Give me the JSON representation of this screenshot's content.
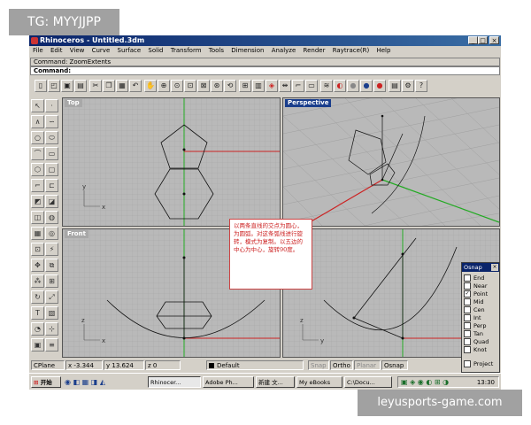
{
  "watermark_top": "TG: MYYJJPP",
  "watermark_bottom": "leyusports-game.com",
  "window": {
    "title": "Rhinoceros - Untitled.3dm",
    "buttons": [
      "_",
      "□",
      "×"
    ]
  },
  "menu": [
    "File",
    "Edit",
    "View",
    "Curve",
    "Surface",
    "Solid",
    "Transform",
    "Tools",
    "Dimension",
    "Analyze",
    "Render",
    "Raytrace(R)",
    "Help"
  ],
  "command_history": "Command: ZoomExtents",
  "command_prompt": "Command:",
  "viewports": {
    "top": "Top",
    "perspective": "Perspective",
    "front": "Front",
    "right": ""
  },
  "annotation": "以两条直线的交点为圆心，为圆弧。对这条弧线进行旋转，模式为复制。以五边的中心为中心，旋转90度。",
  "osnap": {
    "title": "Osnap",
    "close": "×",
    "items": [
      {
        "label": "End",
        "checked": false
      },
      {
        "label": "Near",
        "checked": false
      },
      {
        "label": "Point",
        "checked": true
      },
      {
        "label": "Mid",
        "checked": false
      },
      {
        "label": "Cen",
        "checked": false
      },
      {
        "label": "Int",
        "checked": false
      },
      {
        "label": "Perp",
        "checked": false
      },
      {
        "label": "Tan",
        "checked": false
      },
      {
        "label": "Quad",
        "checked": false
      },
      {
        "label": "Knot",
        "checked": false
      },
      {
        "label": "Project",
        "checked": false
      }
    ]
  },
  "status": {
    "cplane": "CPlane",
    "x": "x -3.344",
    "y": "y 13.624",
    "z": "z 0",
    "layer": "Default",
    "snap": "Snap",
    "ortho": "Ortho",
    "planar": "Planar",
    "osnap": "Osnap"
  },
  "taskbar": {
    "start": "开始",
    "items": [
      "Rhinocer...",
      "Adobe Ph...",
      "新建 文...",
      "My eBooks",
      "C:\\Docu..."
    ],
    "clock": "13:30"
  },
  "axis_labels": {
    "x": "x",
    "y": "y",
    "z": "z"
  },
  "colors": {
    "x_axis": "#cc2222",
    "y_axis": "#22aa22",
    "active_viewport": "#1a3e8c",
    "titlebar": "#0a246a"
  }
}
